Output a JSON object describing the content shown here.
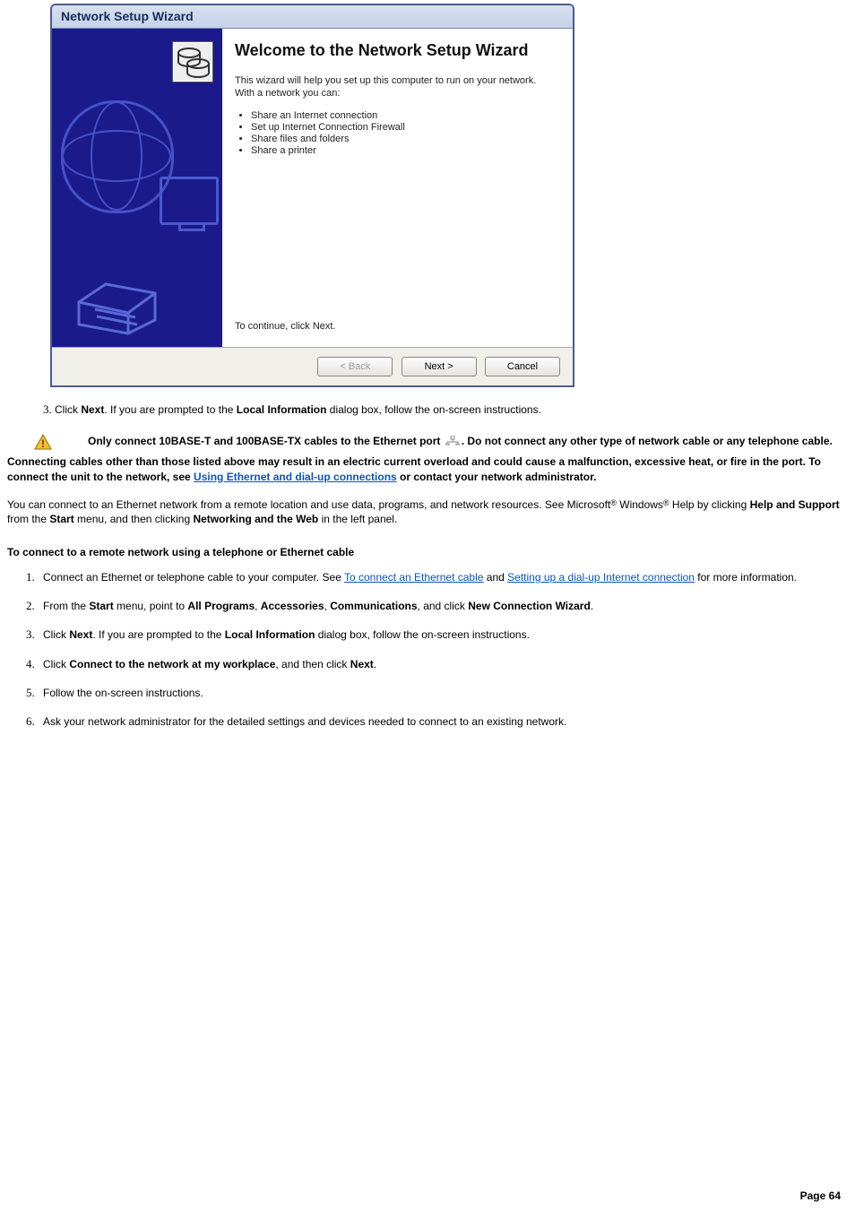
{
  "dialog": {
    "title": "Network Setup Wizard",
    "heading": "Welcome to the Network Setup Wizard",
    "intro": "This wizard will help you set up this computer to run on your network. With a network you can:",
    "bullets": [
      "Share an Internet connection",
      "Set up Internet Connection Firewall",
      "Share files and folders",
      "Share a printer"
    ],
    "continue_text": "To continue, click Next.",
    "back_label": "< Back",
    "next_label": "Next >",
    "cancel_label": "Cancel"
  },
  "step3": {
    "pre": "Click ",
    "b1": "Next",
    "mid": ". If you are prompted to the ",
    "b2": "Local Information",
    "post": " dialog box, follow the on-screen instructions."
  },
  "caution": {
    "s1": "Only connect 10BASE-T and 100BASE-TX cables to the Ethernet port ",
    "s2": ". Do not connect any other type of network cable or any telephone cable. Connecting cables other than those listed above may result in an electric current overload and could cause a malfunction, excessive heat, or fire in the port. To connect the unit to the network, see ",
    "link": "Using Ethernet and dial-up connections",
    "s3": " or contact your network administrator."
  },
  "para1": {
    "a": "You can connect to an Ethernet network from a remote location and use data, programs, and network resources. See Microsoft",
    "reg1": "®",
    "b": " Windows",
    "reg2": "®",
    "c": " Help by clicking ",
    "b1": "Help and Support",
    "d": " from the ",
    "b2": "Start",
    "e": " menu, and then clicking ",
    "b3": "Networking and the Web",
    "f": " in the left panel."
  },
  "subhead": "To connect to a remote network using a telephone or Ethernet cable",
  "remote_steps": {
    "s1a": "Connect an Ethernet or telephone cable to your computer. See ",
    "s1_link1": "To connect an Ethernet cable",
    "s1b": " and ",
    "s1_link2": "Setting up a dial-up Internet connection",
    "s1c": " for more information.",
    "s2a": "From the ",
    "s2_b1": "Start",
    "s2b": " menu, point to ",
    "s2_b2": "All Programs",
    "s2c": ", ",
    "s2_b3": "Accessories",
    "s2d": ", ",
    "s2_b4": "Communications",
    "s2e": ", and click ",
    "s2_b5": "New Connection Wizard",
    "s2f": ".",
    "s3a": "Click ",
    "s3_b1": "Next",
    "s3b": ". If you are prompted to the ",
    "s3_b2": "Local Information",
    "s3c": " dialog box, follow the on-screen instructions.",
    "s4a": "Click ",
    "s4_b1": "Connect to the network at my workplace",
    "s4b": ", and then click ",
    "s4_b2": "Next",
    "s4c": ".",
    "s5": "Follow the on-screen instructions.",
    "s6": "Ask your network administrator for the detailed settings and devices needed to connect to an existing network."
  },
  "footer": "Page 64"
}
